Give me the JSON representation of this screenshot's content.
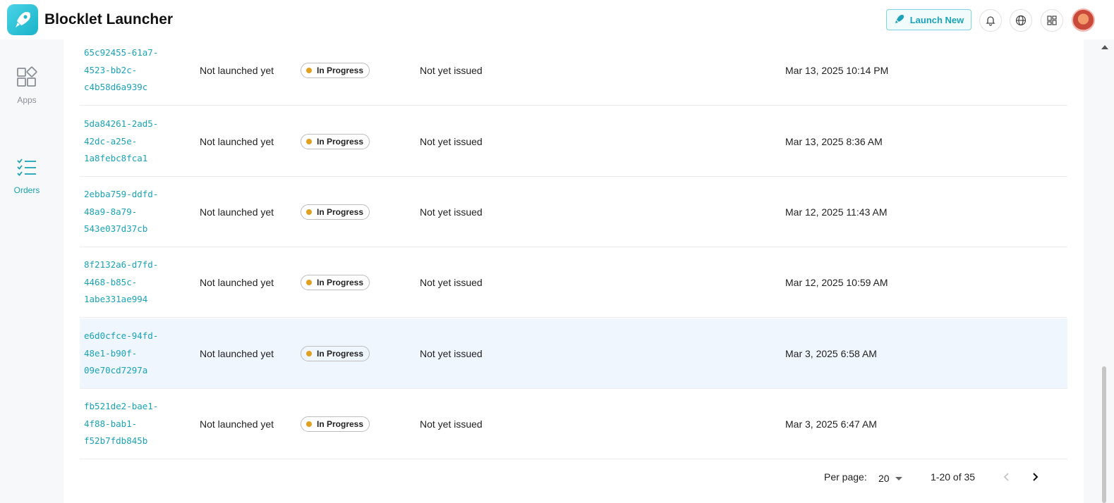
{
  "header": {
    "title": "Blocklet Launcher",
    "launch_label": "Launch New"
  },
  "sidebar": {
    "items": [
      {
        "label": "Apps"
      },
      {
        "label": "Orders"
      }
    ]
  },
  "orders": {
    "rows": [
      {
        "id": "65c92455-61a7-\n4523-bb2c-\nc4b58d6a939c",
        "launch": "Not launched yet",
        "status": "In Progress",
        "certificate": "Not yet issued",
        "date": "Mar 13, 2025 10:14 PM"
      },
      {
        "id": "5da84261-2ad5-\n42dc-a25e-\n1a8febc8fca1",
        "launch": "Not launched yet",
        "status": "In Progress",
        "certificate": "Not yet issued",
        "date": "Mar 13, 2025 8:36 AM"
      },
      {
        "id": "2ebba759-ddfd-\n48a9-8a79-\n543e037d37cb",
        "launch": "Not launched yet",
        "status": "In Progress",
        "certificate": "Not yet issued",
        "date": "Mar 12, 2025 11:43 AM"
      },
      {
        "id": "8f2132a6-d7fd-\n4468-b85c-\n1abe331ae994",
        "launch": "Not launched yet",
        "status": "In Progress",
        "certificate": "Not yet issued",
        "date": "Mar 12, 2025 10:59 AM"
      },
      {
        "id": "e6d0cfce-94fd-\n48e1-b90f-\n09e70cd7297a",
        "launch": "Not launched yet",
        "status": "In Progress",
        "certificate": "Not yet issued",
        "date": "Mar 3, 2025 6:58 AM"
      },
      {
        "id": "fb521de2-bae1-\n4f88-bab1-\nf52b7fdb845b",
        "launch": "Not launched yet",
        "status": "In Progress",
        "certificate": "Not yet issued",
        "date": "Mar 3, 2025 6:47 AM"
      }
    ]
  },
  "pagination": {
    "per_page_label": "Per page:",
    "per_page_value": "20",
    "range": "1-20 of 35"
  },
  "colors": {
    "accent": "#1aa3b8",
    "status_dot": "#e0a021",
    "highlight_row": "#eff6fd"
  }
}
